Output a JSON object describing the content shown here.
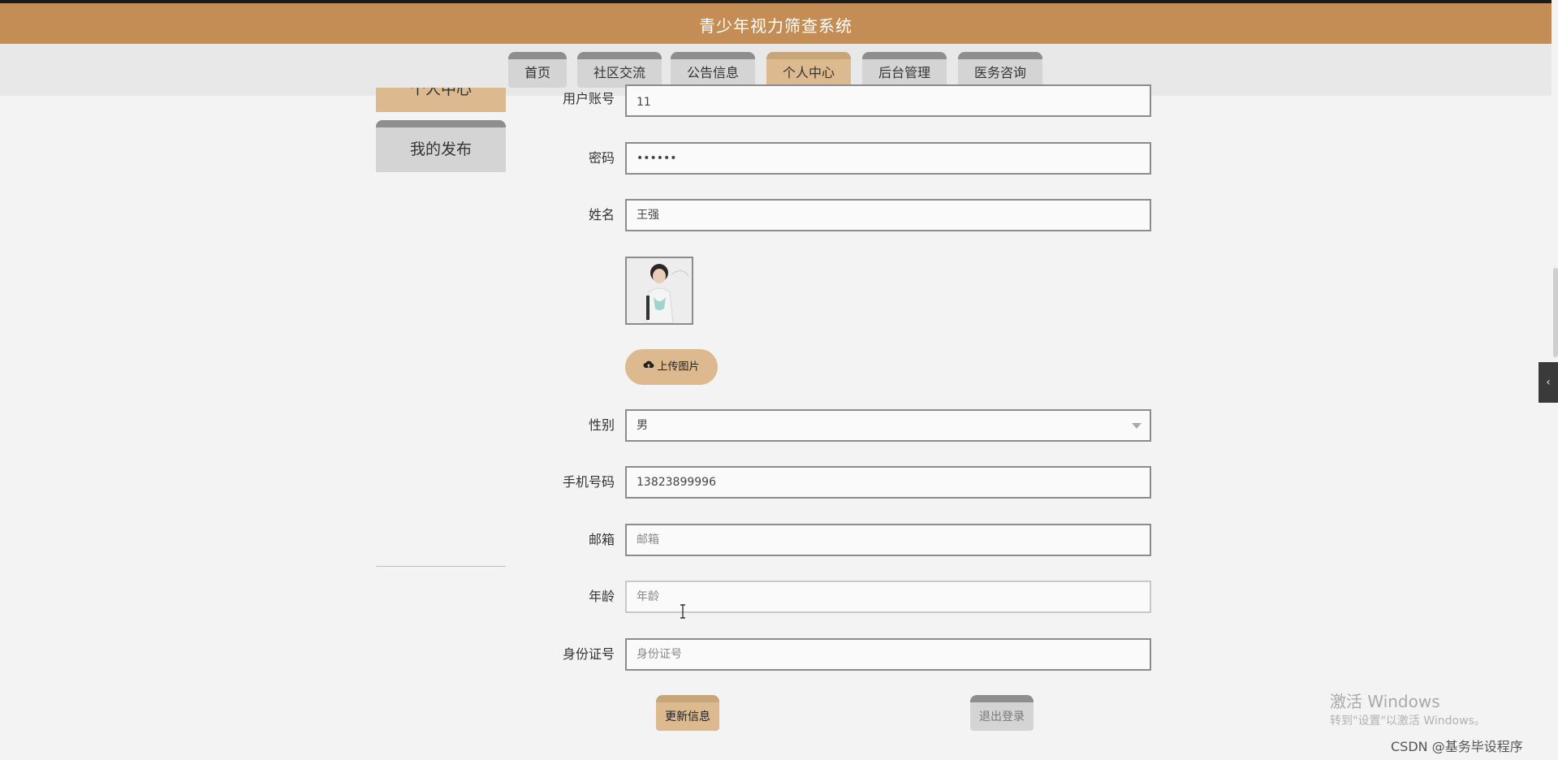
{
  "app": {
    "title": "青少年视力筛查系统"
  },
  "nav": {
    "items": [
      {
        "label": "首页"
      },
      {
        "label": "社区交流"
      },
      {
        "label": "公告信息"
      },
      {
        "label": "个人中心"
      },
      {
        "label": "后台管理"
      },
      {
        "label": "医务咨询"
      }
    ],
    "active_index": 3
  },
  "sidebar": {
    "items": [
      {
        "label": "个人中心"
      },
      {
        "label": "我的发布"
      }
    ]
  },
  "form": {
    "account": {
      "label": "用户账号",
      "value": "11"
    },
    "password": {
      "label": "密码",
      "value": "••••••"
    },
    "name": {
      "label": "姓名",
      "value": "王强"
    },
    "upload_label": "上传图片",
    "gender": {
      "label": "性别",
      "value": "男"
    },
    "phone": {
      "label": "手机号码",
      "value": "13823899996"
    },
    "email": {
      "label": "邮箱",
      "placeholder": "邮箱"
    },
    "age": {
      "label": "年龄",
      "placeholder": "年龄"
    },
    "id_card": {
      "label": "身份证号",
      "placeholder": "身份证号"
    }
  },
  "actions": {
    "update": "更新信息",
    "logout": "退出登录"
  },
  "overlay": {
    "watermark_title": "激活 Windows",
    "watermark_sub": "转到\"设置\"以激活 Windows。",
    "csdn": "CSDN @基务毕设程序"
  },
  "colors": {
    "brand": "#c48d55",
    "accent": "#dcb98e",
    "nav_inactive": "#d4d4d4"
  }
}
